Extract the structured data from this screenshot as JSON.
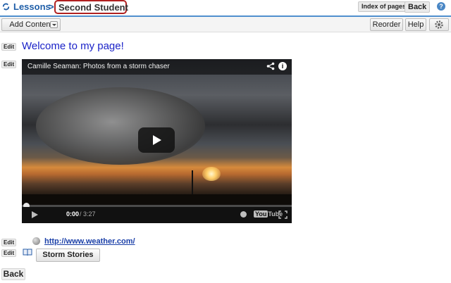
{
  "header": {
    "breadcrumb_root": "Lessons",
    "breadcrumb_separator": ">",
    "breadcrumb_current": "Second Student",
    "index_of_pages_label": "Index of pages",
    "back_label": "Back",
    "help_icon": "?"
  },
  "toolbar": {
    "add_content_label": "Add Content",
    "reorder_label": "Reorder",
    "help_label": "Help"
  },
  "content": {
    "edit_label": "Edit",
    "welcome_text": "Welcome to my page!",
    "video": {
      "title": "Camille Seaman: Photos from a storm chaser",
      "time_current": "0:00",
      "time_separator": " / ",
      "time_total": "3:27",
      "youtube_brand_a": "You",
      "youtube_brand_b": "Tube",
      "info_label": "i",
      "progress": 0
    },
    "link_text": "http://www.weather.com/",
    "storm_stories_label": "Storm Stories",
    "back_label": "Back"
  },
  "colors": {
    "accent_blue": "#1f5ea8",
    "header_rule": "#4f8fce",
    "highlight_red": "#b02020",
    "welcome_blue": "#1a22c8",
    "link_blue": "#1a3fa8"
  },
  "icons": [
    "refresh-icon",
    "help-icon",
    "dropdown-arrow-icon",
    "gear-icon",
    "share-icon",
    "info-icon",
    "play-icon",
    "next-icon",
    "volume-icon",
    "settings-icon",
    "fullscreen-icon",
    "globe-icon",
    "book-icon"
  ]
}
